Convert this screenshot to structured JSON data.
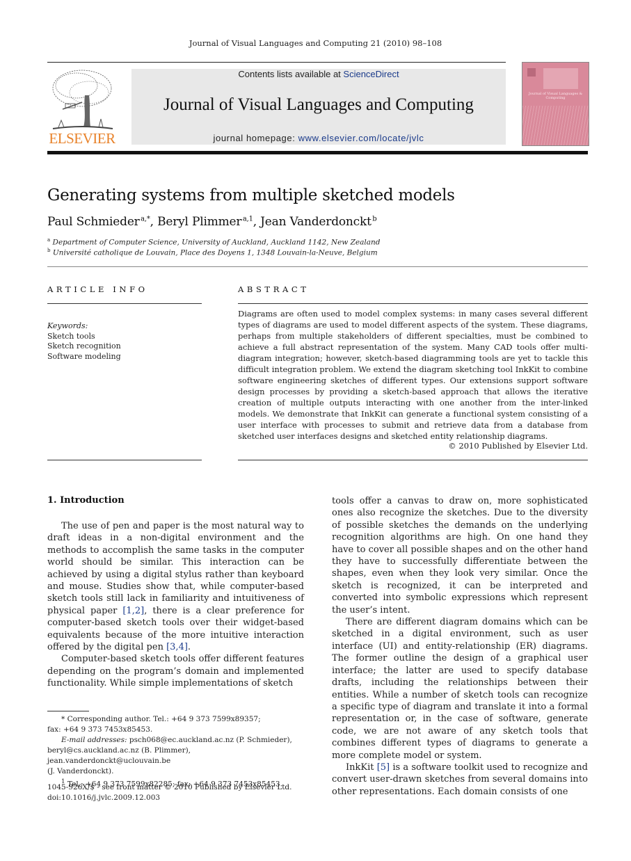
{
  "running_head": "Journal of Visual Languages and Computing 21 (2010) 98–108",
  "masthead": {
    "publisher_logo_text": "ELSEVIER",
    "contents_prefix": "Contents lists available at ",
    "contents_link": "ScienceDirect",
    "journal_title": "Journal of Visual Languages and Computing",
    "homepage_prefix": "journal homepage: ",
    "homepage_link": "www.elsevier.com/locate/jvlc",
    "cover_title": "Journal of Visual Languages & Computing",
    "colors": {
      "logo_orange": "#e8822a",
      "banner_grey": "#e8e8e8",
      "cover_pink": "#d9899a",
      "link_blue": "#1a3a8a"
    }
  },
  "article": {
    "title": "Generating systems from multiple sketched models",
    "authors": [
      {
        "name": "Paul Schmieder",
        "marks": "a,*"
      },
      {
        "name": "Beryl Plimmer",
        "marks": "a,1"
      },
      {
        "name": "Jean Vanderdonckt",
        "marks": "b"
      }
    ],
    "affiliations": [
      {
        "mark": "a",
        "text": "Department of Computer Science, University of Auckland, Auckland 1142, New Zealand"
      },
      {
        "mark": "b",
        "text": "Université catholique de Louvain, Place des Doyens 1, 1348 Louvain-la-Neuve, Belgium"
      }
    ]
  },
  "article_info": {
    "heading": "ARTICLE INFO",
    "keywords_label": "Keywords:",
    "keywords": [
      "Sketch tools",
      "Sketch recognition",
      "Software modeling"
    ]
  },
  "abstract": {
    "heading": "ABSTRACT",
    "text": "Diagrams are often used to model complex systems: in many cases several different types of diagrams are used to model different aspects of the system. These diagrams, perhaps from multiple stakeholders of different specialties, must be combined to achieve a full abstract representation of the system. Many CAD tools offer multi-diagram integration; however, sketch-based diagramming tools are yet to tackle this difficult integration problem. We extend the diagram sketching tool InkKit to combine software engineering sketches of different types. Our extensions support software design processes by providing a sketch-based approach that allows the iterative creation of multiple outputs interacting with one another from the inter-linked models. We demonstrate that InkKit can generate a functional system consisting of a user interface with processes to submit and retrieve data from a database from sketched user interfaces designs and sketched entity relationship diagrams.",
    "copyright": "© 2010 Published by Elsevier Ltd."
  },
  "introduction": {
    "heading": "1.  Introduction",
    "p1_a": "The use of pen and paper is the most natural way to draft ideas in a non-digital environment and the methods to accomplish the same tasks in the computer world should be similar. This interaction can be achieved by using a digital stylus rather than keyboard and mouse. Studies show that, while computer-based sketch tools still lack in familiarity and intuitiveness of physical paper ",
    "ref_1": "[1,2]",
    "p1_b": ", there is a clear preference for computer-based sketch tools over their widget-based equivalents because of the more intuitive interaction offered by the digital pen ",
    "ref_2": "[3,4]",
    "p1_c": ".",
    "p2_left": "Computer-based sketch tools offer different features depending on the program’s domain and implemented functionality. While simple implementations of sketch",
    "p2_right": "tools offer a canvas to draw on, more sophisticated ones also recognize the sketches. Due to the diversity of possible sketches the demands on the underlying recognition algorithms are high. On one hand they have to cover all possible shapes and on the other hand they have to successfully differentiate between the shapes, even when they look very similar. Once the sketch is recognized, it can be interpreted and converted into symbolic expressions which represent the user’s intent.",
    "p3": "There are different diagram domains which can be sketched in a digital environment, such as user interface (UI) and entity-relationship (ER) diagrams. The former outline the design of a graphical user interface; the latter are used to specify database drafts, including the relationships between their entities. While a number of sketch tools can recognize a specific type of diagram and translate it into a formal representation or, in the case of software, generate code, we are not aware of any sketch tools that combines different types of diagrams to generate a more complete model or system.",
    "p4_a": "InkKit ",
    "ref_3": "[5]",
    "p4_b": " is a software toolkit used to recognize and convert user-drawn sketches from several domains into other representations. Each domain consists of one"
  },
  "footnotes": {
    "corresponding": "* Corresponding author. Tel.: +64 9 373 7599x89357;",
    "corresponding_fax": "fax: +64 9 373 7453x85453.",
    "email_label": "E-mail addresses:",
    "email_1": " psch068@ec.auckland.ac.nz (P. Schmieder),",
    "email_2": "beryl@cs.auckland.ac.nz (B. Plimmer), jean.vanderdonckt@uclouvain.be",
    "email_3": "(J. Vanderdonckt).",
    "note_1_mark": "1",
    "note_1": " Tel.: +64 9 373 7599x82285; fax: +64 9 373 7453x85453.",
    "issn": "1045-926X/$ - see front matter © 2010 Published by Elsevier Ltd.",
    "doi": "doi:10.1016/j.jvlc.2009.12.003"
  }
}
